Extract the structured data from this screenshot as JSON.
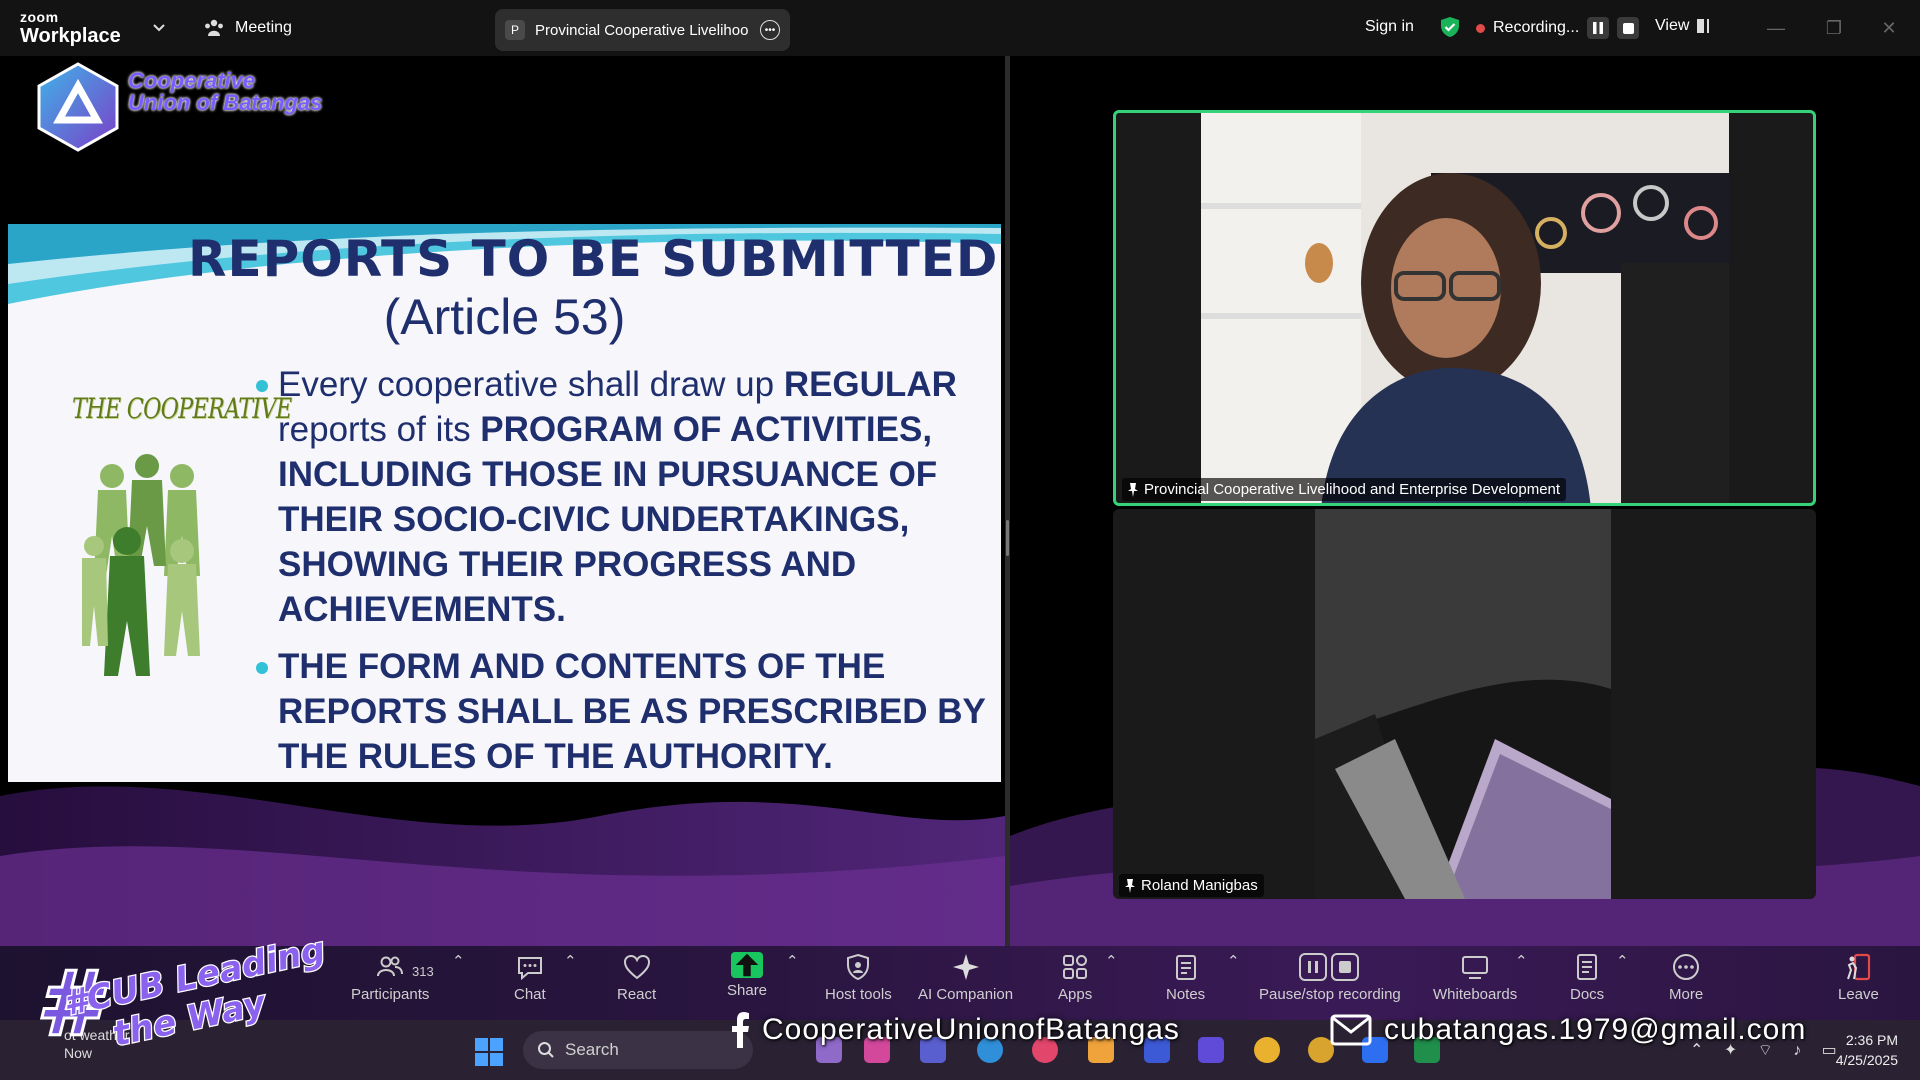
{
  "titlebar": {
    "brand_small": "zoom",
    "brand_large": "Workplace",
    "meeting_label": "Meeting",
    "tab_letter": "P",
    "tab_title": "Provincial Cooperative Livelihoo",
    "sign_in": "Sign in",
    "recording_label": "Recording...",
    "view_label": "View",
    "colors": {
      "shield": "#1bb35a",
      "rec_dot": "#e24a4a"
    }
  },
  "content": {
    "org_name_line1": "Cooperative",
    "org_name_line2": "Union of Batangas",
    "slide": {
      "title": "REPORTS TO BE SUBMITTED",
      "subtitle": "(Article 53)",
      "side_label": "THE COOPERATIVE",
      "bullet1_plain_a": "Every cooperative shall draw up ",
      "bullet1_bold_a": "REGULAR",
      "bullet1_plain_b": " reports of its ",
      "bullet1_bold_b": "PROGRAM OF ACTIVITIES, INCLUDING THOSE IN PURSUANCE OF THEIR SOCIO-CIVIC UNDERTAKINGS, SHOWING THEIR PROGRESS AND ACHIEVEMENTS.",
      "bullet2": "THE FORM AND CONTENTS OF THE REPORTS SHALL BE AS PRESCRIBED BY THE RULES OF THE AUTHORITY."
    }
  },
  "videos": {
    "tile1_name": "Provincial Cooperative Livelihood and Enterprise Development",
    "tile2_name": "Roland Manigbas",
    "active_speaker_border": "#34d37a"
  },
  "toolbar": {
    "participants_label": "Participants",
    "participants_count": "313",
    "chat_label": "Chat",
    "react_label": "React",
    "share_label": "Share",
    "host_tools_label": "Host tools",
    "ai_companion_label": "AI Companion",
    "apps_label": "Apps",
    "notes_label": "Notes",
    "pause_stop_label": "Pause/stop recording",
    "whiteboards_label": "Whiteboards",
    "docs_label": "Docs",
    "more_label": "More",
    "leave_label": "Leave"
  },
  "overlay": {
    "hashtag_line1": "#CUB Leading",
    "hashtag_line2": "the Way",
    "facebook_handle": "CooperativeUnionofBatangas",
    "email": "cubatangas.1979@gmail.com"
  },
  "taskbar": {
    "weather_line1": "ot weather",
    "weather_line2": "Now",
    "search_label": "Search",
    "time": "2:36 PM",
    "date": "4/25/2025"
  }
}
